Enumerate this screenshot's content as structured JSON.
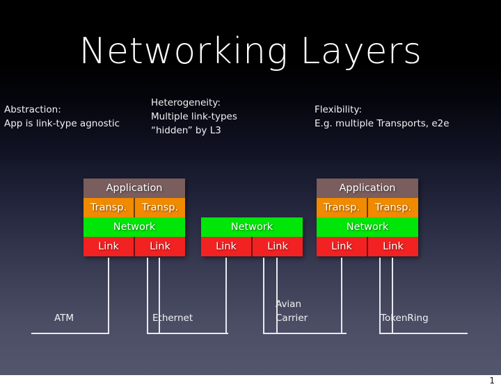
{
  "slide": {
    "title": "Networking Layers",
    "page_number": "1",
    "background_top_color": "#000000",
    "background_bottom_color": "#54566d"
  },
  "captions": [
    {
      "name": "abstraction",
      "text": "Abstraction:\nApp is link-type agnostic"
    },
    {
      "name": "heterogeneity",
      "text": "Heterogeneity:\nMultiple link-types\n“hidden” by L3"
    },
    {
      "name": "flexibility",
      "text": "Flexibility:\nE.g. multiple Transports, e2e"
    }
  ],
  "layer_colors": {
    "application": "#7a5d5d",
    "transport": "#f08a00",
    "network": "#00e609",
    "link": "#f22222"
  },
  "stacks": [
    {
      "name": "host-left",
      "rows": [
        {
          "layer": "application",
          "cells": [
            "Application"
          ]
        },
        {
          "layer": "transport",
          "cells": [
            "Transp.",
            "Transp."
          ]
        },
        {
          "layer": "network",
          "cells": [
            "Network"
          ]
        },
        {
          "layer": "link",
          "cells": [
            "Link",
            "Link"
          ]
        }
      ]
    },
    {
      "name": "router-middle",
      "rows": [
        {
          "layer": "network",
          "cells": [
            "Network"
          ]
        },
        {
          "layer": "link",
          "cells": [
            "Link",
            "Link"
          ]
        }
      ]
    },
    {
      "name": "host-right",
      "rows": [
        {
          "layer": "application",
          "cells": [
            "Application"
          ]
        },
        {
          "layer": "transport",
          "cells": [
            "Transp.",
            "Transp."
          ]
        },
        {
          "layer": "network",
          "cells": [
            "Network"
          ]
        },
        {
          "layer": "link",
          "cells": [
            "Link",
            "Link"
          ]
        }
      ]
    }
  ],
  "link_technologies": [
    {
      "name": "atm",
      "label": "ATM"
    },
    {
      "name": "ethernet",
      "label": "Ethernet"
    },
    {
      "name": "avian",
      "label": "Avian\nCarrier"
    },
    {
      "name": "tokenring",
      "label": "TokenRing"
    }
  ]
}
